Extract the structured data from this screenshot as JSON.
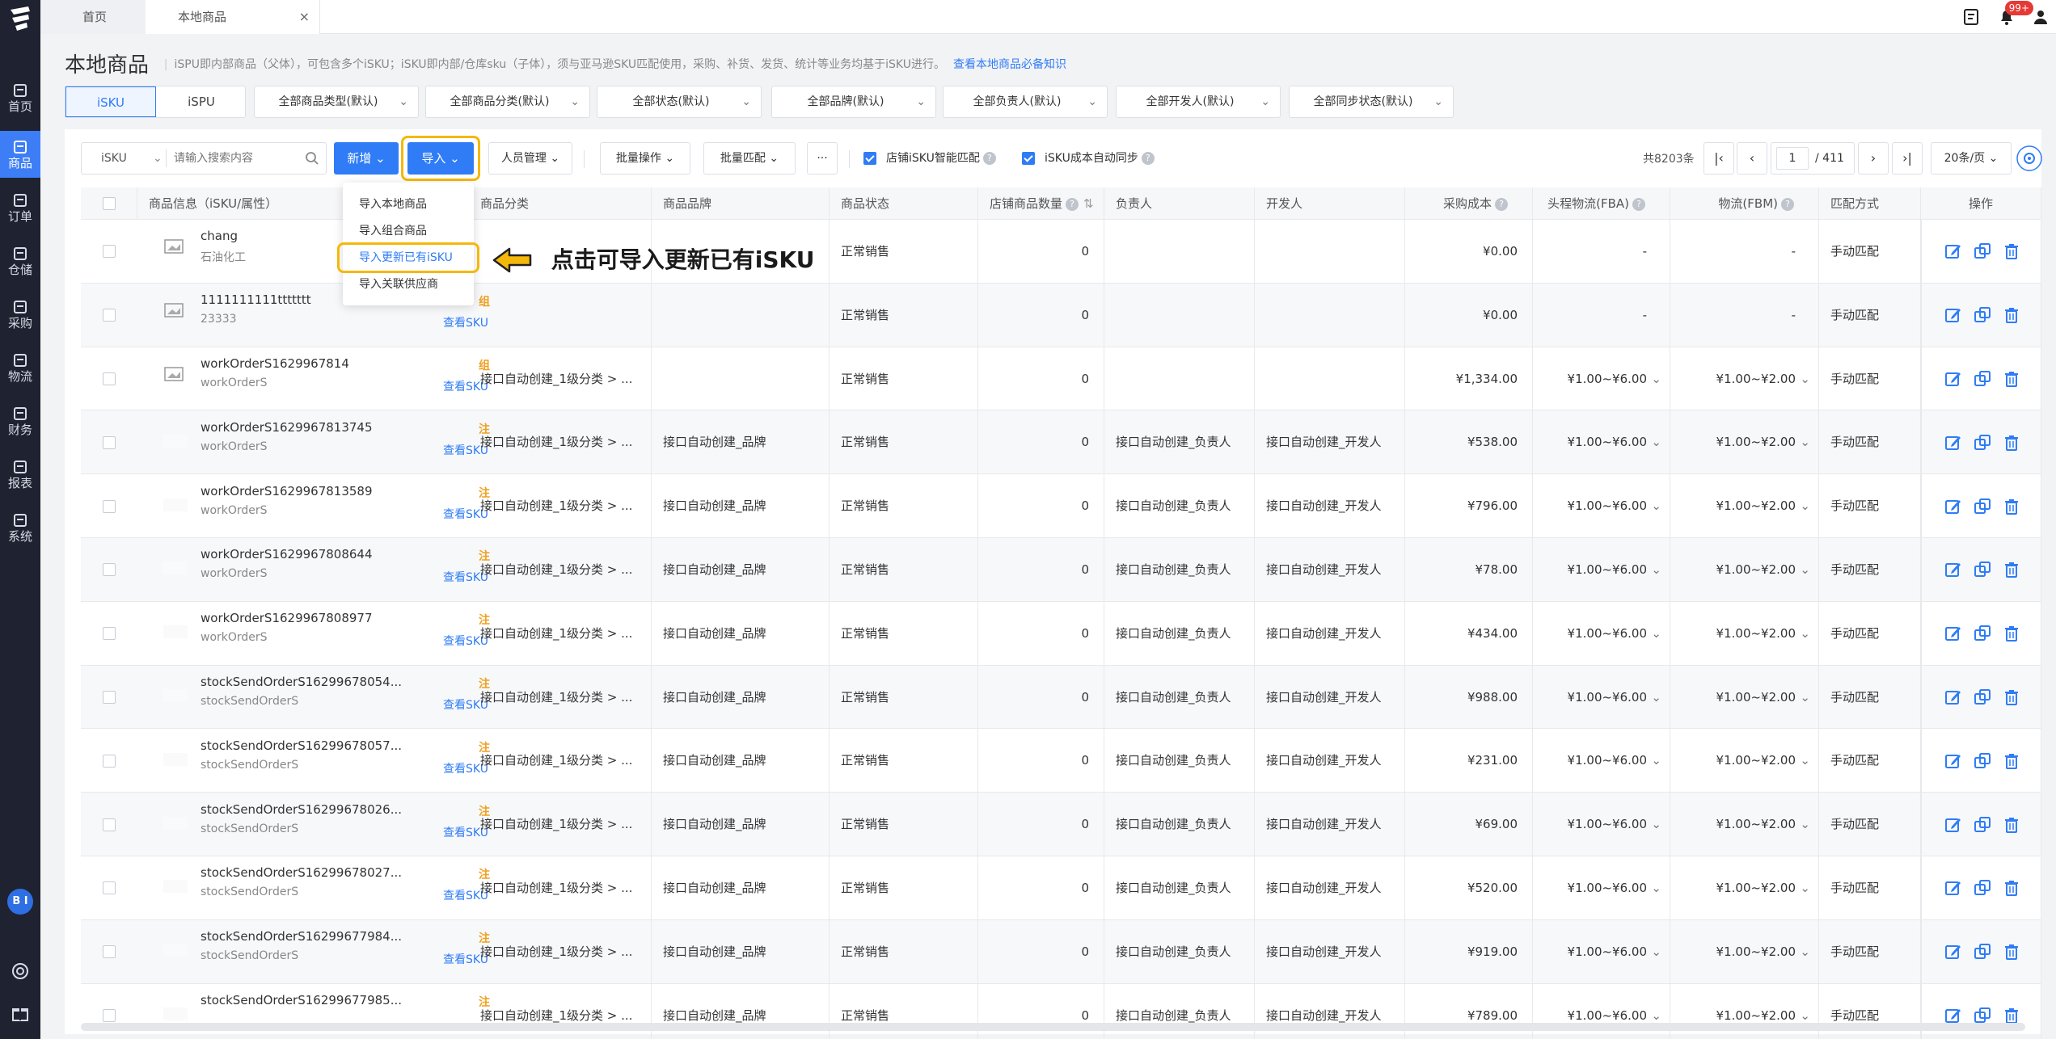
{
  "sidebar": {
    "items": [
      {
        "label": "首页",
        "icon": "home-icon"
      },
      {
        "label": "商品",
        "icon": "box-icon",
        "active": true
      },
      {
        "label": "订单",
        "icon": "order-icon"
      },
      {
        "label": "仓储",
        "icon": "warehouse-icon"
      },
      {
        "label": "采购",
        "icon": "cart-icon"
      },
      {
        "label": "物流",
        "icon": "truck-icon"
      },
      {
        "label": "财务",
        "icon": "finance-icon"
      },
      {
        "label": "报表",
        "icon": "chart-icon"
      },
      {
        "label": "系统",
        "icon": "system-icon"
      }
    ],
    "bi_label": "B I"
  },
  "tabs": [
    {
      "label": "首页"
    },
    {
      "label": "本地商品",
      "close": "×"
    }
  ],
  "top_right": {
    "badge": "99+"
  },
  "page": {
    "title": "本地商品",
    "note": "iSPU即内部商品（父体），可包含多个iSKU；iSKU即内部/仓库sku（子体），须与亚马逊SKU匹配使用，采购、补货、发货、统计等业务均基于iSKU进行。",
    "note_link": "查看本地商品必备知识"
  },
  "toggle": {
    "isku": "iSKU",
    "ispu": "iSPU"
  },
  "filters": [
    "全部商品类型(默认)",
    "全部商品分类(默认)",
    "全部状态(默认)",
    "全部品牌(默认)",
    "全部负责人(默认)",
    "全部开发人(默认)",
    "全部同步状态(默认)"
  ],
  "toolbar": {
    "search_type": "iSKU",
    "search_placeholder": "请输入搜索内容",
    "new_label": "新增",
    "import_label": "导入",
    "staff_label": "人员管理",
    "batch_label": "批量操作",
    "match_label": "批量匹配",
    "more_label": "···",
    "check1_label": "店铺iSKU智能匹配",
    "check2_label": "iSKU成本自动同步",
    "total": "共8203条",
    "page_current": "1",
    "page_total": "/ 411",
    "page_size": "20条/页"
  },
  "import_menu": {
    "items": [
      "导入本地商品",
      "导入组合商品",
      "导入更新已有iSKU",
      "导入关联供应商"
    ]
  },
  "callout": "点击可导入更新已有iSKU",
  "columns": [
    "商品信息（iSKU/属性）",
    "商品分类",
    "商品品牌",
    "商品状态",
    "店铺商品数量",
    "负责人",
    "开发人",
    "采购成本",
    "头程物流(FBA)",
    "物流(FBM)",
    "匹配方式",
    "操作"
  ],
  "rows": [
    {
      "name": "chang",
      "sub": "石油化工",
      "tag": "",
      "link": "",
      "category": "",
      "brand": "",
      "status": "正常销售",
      "qty": "0",
      "owner": "",
      "dev": "",
      "cost": "¥0.00",
      "fba": "-",
      "fbm": "-",
      "match": "手动匹配",
      "img": true
    },
    {
      "name": "1111111111ttttttt",
      "sub": "23333",
      "tag": "组",
      "link": "查看SKU",
      "category": "",
      "brand": "",
      "status": "正常销售",
      "qty": "0",
      "owner": "",
      "dev": "",
      "cost": "¥0.00",
      "fba": "-",
      "fbm": "-",
      "match": "手动匹配",
      "img": true
    },
    {
      "name": "workOrderS1629967814",
      "sub": "workOrderS",
      "tag": "组",
      "link": "查看SKU",
      "category": "接口自动创建_1级分类 > ...",
      "brand": "",
      "status": "正常销售",
      "qty": "0",
      "owner": "",
      "dev": "",
      "cost": "¥1,334.00",
      "fba": "¥1.00~¥6.00",
      "fbm": "¥1.00~¥2.00",
      "match": "手动匹配",
      "img": true
    },
    {
      "name": "workOrderS1629967813745",
      "sub": "workOrderS",
      "tag": "注",
      "link": "查看SKU",
      "category": "接口自动创建_1级分类 > ...",
      "brand": "接口自动创建_品牌",
      "status": "正常销售",
      "qty": "0",
      "owner": "接口自动创建_负责人",
      "dev": "接口自动创建_开发人",
      "cost": "¥538.00",
      "fba": "¥1.00~¥6.00",
      "fbm": "¥1.00~¥2.00",
      "match": "手动匹配",
      "img": false
    },
    {
      "name": "workOrderS1629967813589",
      "sub": "workOrderS",
      "tag": "注",
      "link": "查看SKU",
      "category": "接口自动创建_1级分类 > ...",
      "brand": "接口自动创建_品牌",
      "status": "正常销售",
      "qty": "0",
      "owner": "接口自动创建_负责人",
      "dev": "接口自动创建_开发人",
      "cost": "¥796.00",
      "fba": "¥1.00~¥6.00",
      "fbm": "¥1.00~¥2.00",
      "match": "手动匹配",
      "img": false
    },
    {
      "name": "workOrderS1629967808644",
      "sub": "workOrderS",
      "tag": "注",
      "link": "查看SKU",
      "category": "接口自动创建_1级分类 > ...",
      "brand": "接口自动创建_品牌",
      "status": "正常销售",
      "qty": "0",
      "owner": "接口自动创建_负责人",
      "dev": "接口自动创建_开发人",
      "cost": "¥78.00",
      "fba": "¥1.00~¥6.00",
      "fbm": "¥1.00~¥2.00",
      "match": "手动匹配",
      "img": false
    },
    {
      "name": "workOrderS1629967808977",
      "sub": "workOrderS",
      "tag": "注",
      "link": "查看SKU",
      "category": "接口自动创建_1级分类 > ...",
      "brand": "接口自动创建_品牌",
      "status": "正常销售",
      "qty": "0",
      "owner": "接口自动创建_负责人",
      "dev": "接口自动创建_开发人",
      "cost": "¥434.00",
      "fba": "¥1.00~¥6.00",
      "fbm": "¥1.00~¥2.00",
      "match": "手动匹配",
      "img": false
    },
    {
      "name": "stockSendOrderS16299678054...",
      "sub": "stockSendOrderS",
      "tag": "注",
      "link": "查看SKU",
      "category": "接口自动创建_1级分类 > ...",
      "brand": "接口自动创建_品牌",
      "status": "正常销售",
      "qty": "0",
      "owner": "接口自动创建_负责人",
      "dev": "接口自动创建_开发人",
      "cost": "¥988.00",
      "fba": "¥1.00~¥6.00",
      "fbm": "¥1.00~¥2.00",
      "match": "手动匹配",
      "img": false
    },
    {
      "name": "stockSendOrderS16299678057...",
      "sub": "stockSendOrderS",
      "tag": "注",
      "link": "查看SKU",
      "category": "接口自动创建_1级分类 > ...",
      "brand": "接口自动创建_品牌",
      "status": "正常销售",
      "qty": "0",
      "owner": "接口自动创建_负责人",
      "dev": "接口自动创建_开发人",
      "cost": "¥231.00",
      "fba": "¥1.00~¥6.00",
      "fbm": "¥1.00~¥2.00",
      "match": "手动匹配",
      "img": false
    },
    {
      "name": "stockSendOrderS16299678026...",
      "sub": "stockSendOrderS",
      "tag": "注",
      "link": "查看SKU",
      "category": "接口自动创建_1级分类 > ...",
      "brand": "接口自动创建_品牌",
      "status": "正常销售",
      "qty": "0",
      "owner": "接口自动创建_负责人",
      "dev": "接口自动创建_开发人",
      "cost": "¥69.00",
      "fba": "¥1.00~¥6.00",
      "fbm": "¥1.00~¥2.00",
      "match": "手动匹配",
      "img": false
    },
    {
      "name": "stockSendOrderS16299678027...",
      "sub": "stockSendOrderS",
      "tag": "注",
      "link": "查看SKU",
      "category": "接口自动创建_1级分类 > ...",
      "brand": "接口自动创建_品牌",
      "status": "正常销售",
      "qty": "0",
      "owner": "接口自动创建_负责人",
      "dev": "接口自动创建_开发人",
      "cost": "¥520.00",
      "fba": "¥1.00~¥6.00",
      "fbm": "¥1.00~¥2.00",
      "match": "手动匹配",
      "img": false
    },
    {
      "name": "stockSendOrderS16299677984...",
      "sub": "stockSendOrderS",
      "tag": "注",
      "link": "查看SKU",
      "category": "接口自动创建_1级分类 > ...",
      "brand": "接口自动创建_品牌",
      "status": "正常销售",
      "qty": "0",
      "owner": "接口自动创建_负责人",
      "dev": "接口自动创建_开发人",
      "cost": "¥919.00",
      "fba": "¥1.00~¥6.00",
      "fbm": "¥1.00~¥2.00",
      "match": "手动匹配",
      "img": false
    },
    {
      "name": "stockSendOrderS16299677985...",
      "sub": "",
      "tag": "注",
      "link": "",
      "category": "接口自动创建_1级分类 > ...",
      "brand": "接口自动创建_品牌",
      "status": "正常销售",
      "qty": "0",
      "owner": "接口自动创建_负责人",
      "dev": "接口自动创建_开发人",
      "cost": "¥789.00",
      "fba": "¥1.00~¥6.00",
      "fbm": "¥1.00~¥2.00",
      "match": "手动匹配",
      "img": false
    }
  ],
  "colors": {
    "accent": "#2f7cf6",
    "sidebar": "#1f2230",
    "highlight": "#f5b80a",
    "tag": "#f0a020",
    "badge": "#e53935"
  }
}
